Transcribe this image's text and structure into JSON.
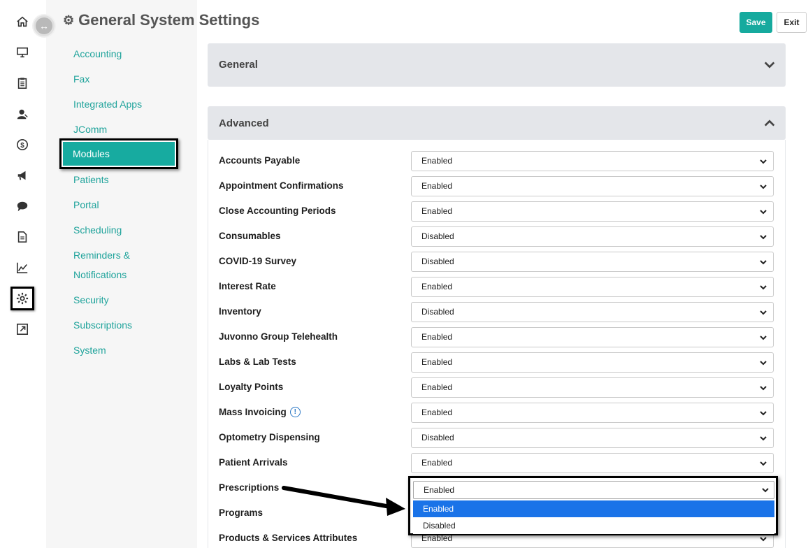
{
  "rail": {
    "icons": [
      "home-icon",
      "desktop-icon",
      "clipboard-icon",
      "user-icon",
      "dollar-icon",
      "megaphone-icon",
      "chat-icon",
      "document-icon",
      "chart-icon",
      "gear-icon",
      "external-link-icon"
    ],
    "active": "gear-icon"
  },
  "header": {
    "title": "General System Settings",
    "save_label": "Save",
    "exit_label": "Exit"
  },
  "subnav": {
    "items": [
      {
        "label": "Accounting"
      },
      {
        "label": "Fax"
      },
      {
        "label": "Integrated Apps"
      },
      {
        "label": "JComm"
      },
      {
        "label": "Modules"
      },
      {
        "label": "Patients"
      },
      {
        "label": "Portal"
      },
      {
        "label": "Scheduling"
      },
      {
        "label": "Reminders &"
      },
      {
        "label": "Notifications"
      },
      {
        "label": "Security"
      },
      {
        "label": "Subscriptions"
      },
      {
        "label": "System"
      }
    ],
    "active": "Modules"
  },
  "panels": {
    "general": {
      "title": "General",
      "state": "collapsed"
    },
    "advanced": {
      "title": "Advanced",
      "state": "expanded"
    }
  },
  "settings": [
    {
      "label": "Accounts Payable",
      "value": "Enabled"
    },
    {
      "label": "Appointment Confirmations",
      "value": "Enabled"
    },
    {
      "label": "Close Accounting Periods",
      "value": "Enabled"
    },
    {
      "label": "Consumables",
      "value": "Disabled"
    },
    {
      "label": "COVID-19 Survey",
      "value": "Disabled"
    },
    {
      "label": "Interest Rate",
      "value": "Enabled"
    },
    {
      "label": "Inventory",
      "value": "Disabled"
    },
    {
      "label": "Juvonno Group Telehealth",
      "value": "Enabled"
    },
    {
      "label": "Labs & Lab Tests",
      "value": "Enabled"
    },
    {
      "label": "Loyalty Points",
      "value": "Enabled"
    },
    {
      "label": "Mass Invoicing",
      "value": "Enabled"
    },
    {
      "label": "Optometry Dispensing",
      "value": "Disabled"
    },
    {
      "label": "Patient Arrivals",
      "value": "Enabled"
    },
    {
      "label": "Prescriptions",
      "value": "Enabled"
    },
    {
      "label": "Programs",
      "value": ""
    },
    {
      "label": "Products & Services Attributes",
      "value": "Enabled"
    }
  ],
  "dropdown": {
    "field": "Prescriptions",
    "selected": "Enabled",
    "options": [
      "Enabled",
      "Disabled"
    ],
    "highlighted": "Enabled"
  },
  "colors": {
    "accent": "#17aba0",
    "link": "#1fa39b",
    "panel_header": "#e4e6ea",
    "highlight_option": "#1a73e8"
  }
}
